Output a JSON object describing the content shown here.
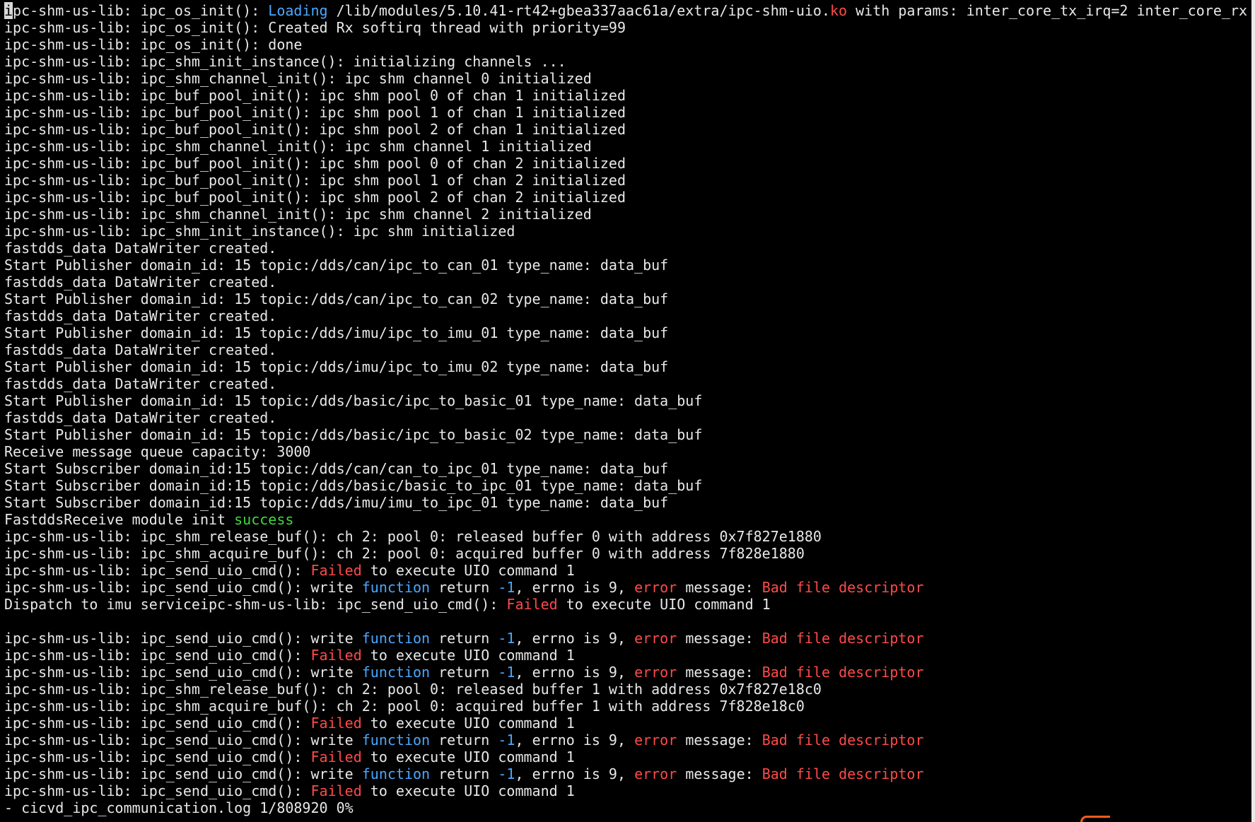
{
  "colors": {
    "background": "#000000",
    "text": "#e8e8e8",
    "blue": "#4aa8ff",
    "red": "#ff4a4a",
    "green": "#3ddc3d",
    "status_prompt": "#e8e8e8"
  },
  "terminal": {
    "lines": [
      [
        {
          "t": "i",
          "c": "cursor"
        },
        {
          "t": "pc-shm-us-lib: ipc_os_init(): "
        },
        {
          "t": "Loading",
          "c": "blue"
        },
        {
          "t": " /lib/modules/5.10.41-rt42+gbea337aac61a/extra/ipc-shm-uio."
        },
        {
          "t": "ko",
          "c": "red"
        },
        {
          "t": " with params: inter_core_tx_irq=2 inter_core_rx"
        }
      ],
      [
        {
          "t": "ipc-shm-us-lib: ipc_os_init(): Created Rx softirq thread with priority=99"
        }
      ],
      [
        {
          "t": "ipc-shm-us-lib: ipc_os_init(): done"
        }
      ],
      [
        {
          "t": "ipc-shm-us-lib: ipc_shm_init_instance(): initializing channels ..."
        }
      ],
      [
        {
          "t": "ipc-shm-us-lib: ipc_shm_channel_init(): ipc shm channel 0 initialized"
        }
      ],
      [
        {
          "t": "ipc-shm-us-lib: ipc_buf_pool_init(): ipc shm pool 0 of chan 1 initialized"
        }
      ],
      [
        {
          "t": "ipc-shm-us-lib: ipc_buf_pool_init(): ipc shm pool 1 of chan 1 initialized"
        }
      ],
      [
        {
          "t": "ipc-shm-us-lib: ipc_buf_pool_init(): ipc shm pool 2 of chan 1 initialized"
        }
      ],
      [
        {
          "t": "ipc-shm-us-lib: ipc_shm_channel_init(): ipc shm channel 1 initialized"
        }
      ],
      [
        {
          "t": "ipc-shm-us-lib: ipc_buf_pool_init(): ipc shm pool 0 of chan 2 initialized"
        }
      ],
      [
        {
          "t": "ipc-shm-us-lib: ipc_buf_pool_init(): ipc shm pool 1 of chan 2 initialized"
        }
      ],
      [
        {
          "t": "ipc-shm-us-lib: ipc_buf_pool_init(): ipc shm pool 2 of chan 2 initialized"
        }
      ],
      [
        {
          "t": "ipc-shm-us-lib: ipc_shm_channel_init(): ipc shm channel 2 initialized"
        }
      ],
      [
        {
          "t": "ipc-shm-us-lib: ipc_shm_init_instance(): ipc shm initialized"
        }
      ],
      [
        {
          "t": "fastdds_data DataWriter created."
        }
      ],
      [
        {
          "t": "Start Publisher domain_id: 15 topic:/dds/can/ipc_to_can_01 type_name: data_buf"
        }
      ],
      [
        {
          "t": "fastdds_data DataWriter created."
        }
      ],
      [
        {
          "t": "Start Publisher domain_id: 15 topic:/dds/can/ipc_to_can_02 type_name: data_buf"
        }
      ],
      [
        {
          "t": "fastdds_data DataWriter created."
        }
      ],
      [
        {
          "t": "Start Publisher domain_id: 15 topic:/dds/imu/ipc_to_imu_01 type_name: data_buf"
        }
      ],
      [
        {
          "t": "fastdds_data DataWriter created."
        }
      ],
      [
        {
          "t": "Start Publisher domain_id: 15 topic:/dds/imu/ipc_to_imu_02 type_name: data_buf"
        }
      ],
      [
        {
          "t": "fastdds_data DataWriter created."
        }
      ],
      [
        {
          "t": "Start Publisher domain_id: 15 topic:/dds/basic/ipc_to_basic_01 type_name: data_buf"
        }
      ],
      [
        {
          "t": "fastdds_data DataWriter created."
        }
      ],
      [
        {
          "t": "Start Publisher domain_id: 15 topic:/dds/basic/ipc_to_basic_02 type_name: data_buf"
        }
      ],
      [
        {
          "t": "Receive message queue capacity: 3000"
        }
      ],
      [
        {
          "t": "Start Subscriber domain_id:15 topic:/dds/can/can_to_ipc_01 type_name: data_buf"
        }
      ],
      [
        {
          "t": "Start Subscriber domain_id:15 topic:/dds/basic/basic_to_ipc_01 type_name: data_buf"
        }
      ],
      [
        {
          "t": "Start Subscriber domain_id:15 topic:/dds/imu/imu_to_ipc_01 type_name: data_buf"
        }
      ],
      [
        {
          "t": "FastddsReceive module init "
        },
        {
          "t": "success",
          "c": "green"
        }
      ],
      [
        {
          "t": "ipc-shm-us-lib: ipc_shm_release_buf(): ch 2: pool 0: released buffer 0 with address 0x7f827e1880"
        }
      ],
      [
        {
          "t": "ipc-shm-us-lib: ipc_shm_acquire_buf(): ch 2: pool 0: acquired buffer 0 with address 7f828e1880"
        }
      ],
      [
        {
          "t": "ipc-shm-us-lib: ipc_send_uio_cmd(): "
        },
        {
          "t": "Failed",
          "c": "red"
        },
        {
          "t": " to execute UIO command 1"
        }
      ],
      [
        {
          "t": "ipc-shm-us-lib: ipc_send_uio_cmd(): write "
        },
        {
          "t": "function",
          "c": "blue"
        },
        {
          "t": " return "
        },
        {
          "t": "-1",
          "c": "blue"
        },
        {
          "t": ", errno is 9, "
        },
        {
          "t": "error",
          "c": "red"
        },
        {
          "t": " message: "
        },
        {
          "t": "Bad file descriptor",
          "c": "red"
        }
      ],
      [
        {
          "t": "Dispatch to imu serviceipc-shm-us-lib: ipc_send_uio_cmd(): "
        },
        {
          "t": "Failed",
          "c": "red"
        },
        {
          "t": " to execute UIO command 1"
        }
      ],
      [
        {
          "t": ""
        }
      ],
      [
        {
          "t": "ipc-shm-us-lib: ipc_send_uio_cmd(): write "
        },
        {
          "t": "function",
          "c": "blue"
        },
        {
          "t": " return "
        },
        {
          "t": "-1",
          "c": "blue"
        },
        {
          "t": ", errno is 9, "
        },
        {
          "t": "error",
          "c": "red"
        },
        {
          "t": " message: "
        },
        {
          "t": "Bad file descriptor",
          "c": "red"
        }
      ],
      [
        {
          "t": "ipc-shm-us-lib: ipc_send_uio_cmd(): "
        },
        {
          "t": "Failed",
          "c": "red"
        },
        {
          "t": " to execute UIO command 1"
        }
      ],
      [
        {
          "t": "ipc-shm-us-lib: ipc_send_uio_cmd(): write "
        },
        {
          "t": "function",
          "c": "blue"
        },
        {
          "t": " return "
        },
        {
          "t": "-1",
          "c": "blue"
        },
        {
          "t": ", errno is 9, "
        },
        {
          "t": "error",
          "c": "red"
        },
        {
          "t": " message: "
        },
        {
          "t": "Bad file descriptor",
          "c": "red"
        }
      ],
      [
        {
          "t": "ipc-shm-us-lib: ipc_shm_release_buf(): ch 2: pool 0: released buffer 1 with address 0x7f827e18c0"
        }
      ],
      [
        {
          "t": "ipc-shm-us-lib: ipc_shm_acquire_buf(): ch 2: pool 0: acquired buffer 1 with address 7f828e18c0"
        }
      ],
      [
        {
          "t": "ipc-shm-us-lib: ipc_send_uio_cmd(): "
        },
        {
          "t": "Failed",
          "c": "red"
        },
        {
          "t": " to execute UIO command 1"
        }
      ],
      [
        {
          "t": "ipc-shm-us-lib: ipc_send_uio_cmd(): write "
        },
        {
          "t": "function",
          "c": "blue"
        },
        {
          "t": " return "
        },
        {
          "t": "-1",
          "c": "blue"
        },
        {
          "t": ", errno is 9, "
        },
        {
          "t": "error",
          "c": "red"
        },
        {
          "t": " message: "
        },
        {
          "t": "Bad file descriptor",
          "c": "red"
        }
      ],
      [
        {
          "t": "ipc-shm-us-lib: ipc_send_uio_cmd(): "
        },
        {
          "t": "Failed",
          "c": "red"
        },
        {
          "t": " to execute UIO command 1"
        }
      ],
      [
        {
          "t": "ipc-shm-us-lib: ipc_send_uio_cmd(): write "
        },
        {
          "t": "function",
          "c": "blue"
        },
        {
          "t": " return "
        },
        {
          "t": "-1",
          "c": "blue"
        },
        {
          "t": ", errno is 9, "
        },
        {
          "t": "error",
          "c": "red"
        },
        {
          "t": " message: "
        },
        {
          "t": "Bad file descriptor",
          "c": "red"
        }
      ],
      [
        {
          "t": "ipc-shm-us-lib: ipc_send_uio_cmd(): "
        },
        {
          "t": "Failed",
          "c": "red"
        },
        {
          "t": " to execute UIO command 1"
        }
      ]
    ],
    "status_line": "- cicvd_ipc_communication.log 1/808920 0%"
  }
}
